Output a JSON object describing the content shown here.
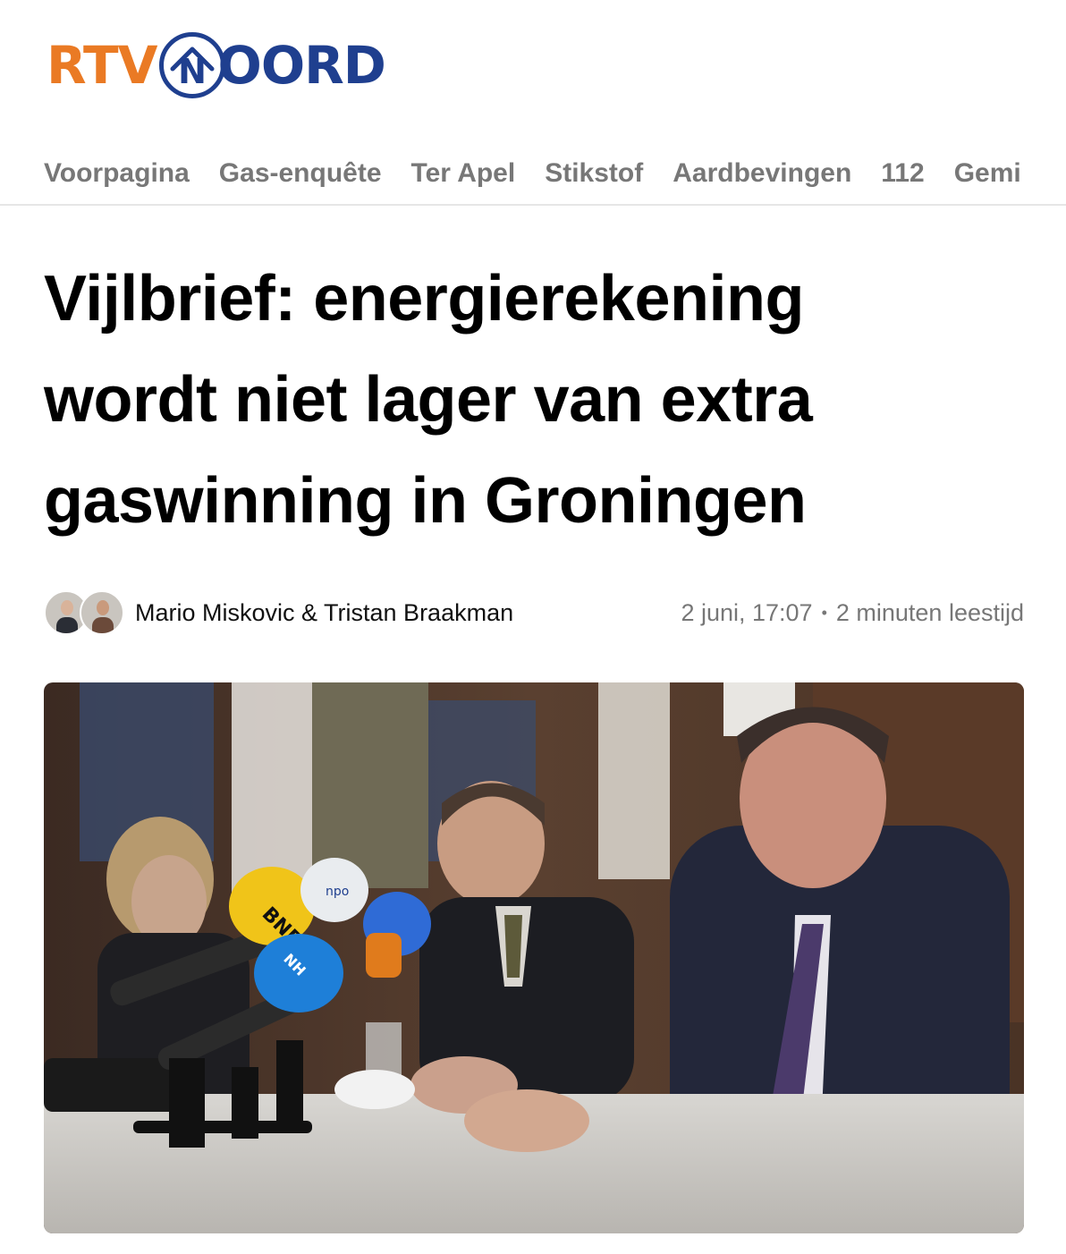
{
  "brand": {
    "part1": "RTV",
    "emblem_letter": "N",
    "part2": "OORD",
    "color_orange": "#ea7a24",
    "color_blue": "#1f3f8f"
  },
  "nav": {
    "items": [
      "Voorpagina",
      "Gas-enquête",
      "Ter Apel",
      "Stikstof",
      "Aardbevingen",
      "112",
      "Gemi"
    ]
  },
  "article": {
    "title": "Vijlbrief: energierekening wordt niet lager van extra gaswinning in Groningen",
    "authors": "Mario Miskovic & Tristan Braakman",
    "date": "2 juni, 17:07",
    "separator": "•",
    "reading_time": "2 minuten leestijd"
  },
  "photo": {
    "mic_labels": [
      "BNR",
      "npo",
      "NH"
    ]
  }
}
